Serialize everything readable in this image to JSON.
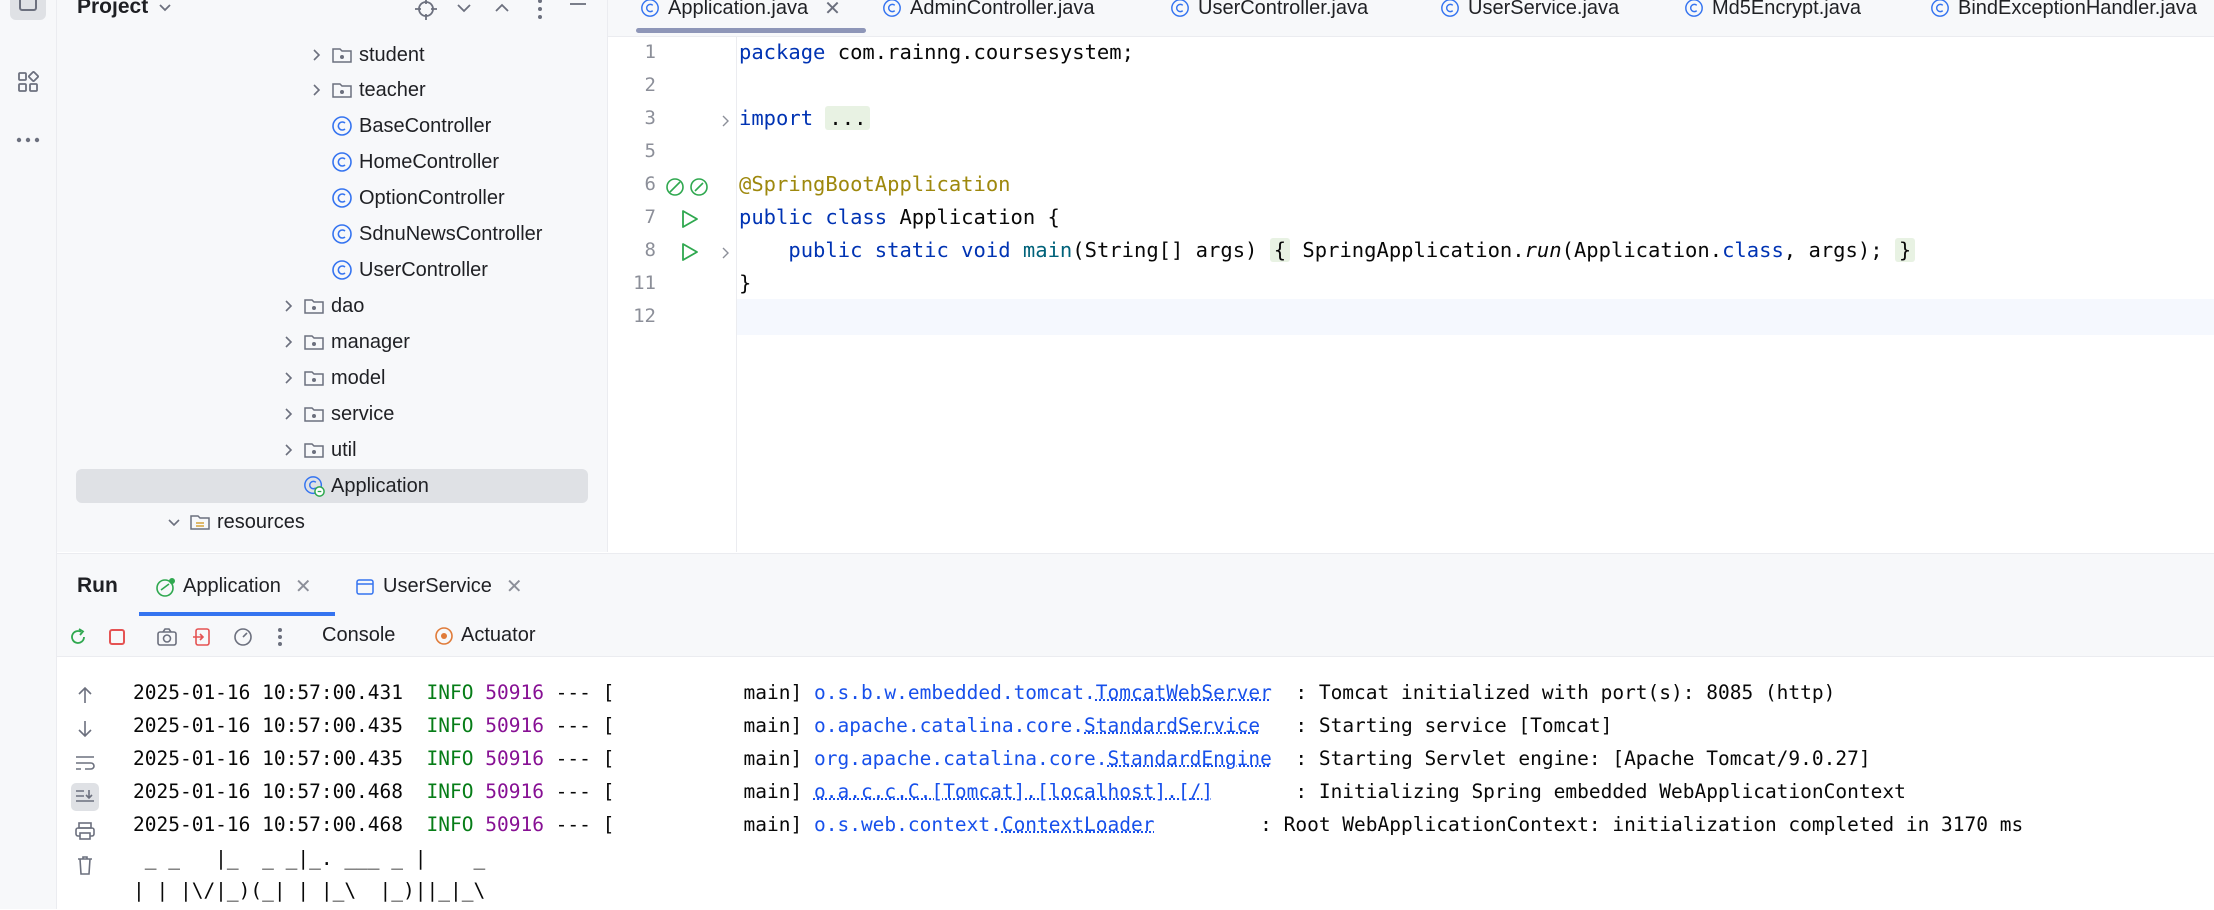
{
  "project_panel": {
    "title": "Project",
    "tree": [
      {
        "label": "student",
        "kind": "folder"
      },
      {
        "label": "teacher",
        "kind": "folder"
      },
      {
        "label": "BaseController",
        "kind": "class"
      },
      {
        "label": "HomeController",
        "kind": "class"
      },
      {
        "label": "OptionController",
        "kind": "class"
      },
      {
        "label": "SdnuNewsController",
        "kind": "class"
      },
      {
        "label": "UserController",
        "kind": "class"
      },
      {
        "label": "dao",
        "kind": "folder"
      },
      {
        "label": "manager",
        "kind": "folder"
      },
      {
        "label": "model",
        "kind": "folder"
      },
      {
        "label": "service",
        "kind": "folder"
      },
      {
        "label": "util",
        "kind": "folder"
      },
      {
        "label": "Application",
        "kind": "spring-class"
      },
      {
        "label": "resources",
        "kind": "resources-folder"
      }
    ]
  },
  "editor_tabs": [
    {
      "label": "Application.java"
    },
    {
      "label": "AdminController.java"
    },
    {
      "label": "UserController.java"
    },
    {
      "label": "UserService.java"
    },
    {
      "label": "Md5Encrypt.java"
    },
    {
      "label": "BindExceptionHandler.java"
    }
  ],
  "editor": {
    "line_numbers": [
      "1",
      "2",
      "3",
      "5",
      "6",
      "7",
      "8",
      "11",
      "12"
    ],
    "code": {
      "package_kw": "package",
      "package_name": " com.rainng.coursesystem;",
      "import_kw": "import",
      "import_fold": "...",
      "annotation": "@SpringBootApplication",
      "class_kw": "public class",
      "class_name": " Application {",
      "main_kw": "public static void",
      "main_name": "main",
      "main_params": "(String[] args) ",
      "main_fold_open": "{",
      "main_body_a": " SpringApplication.",
      "main_body_run": "run",
      "main_body_b": "(Application.",
      "main_body_class": "class",
      "main_body_c": ", args); ",
      "main_fold_close": "}",
      "closing": "}"
    }
  },
  "run_panel": {
    "title": "Run",
    "tabs": [
      {
        "label": "Application"
      },
      {
        "label": "UserService"
      }
    ],
    "console_tabs": [
      {
        "label": "Console"
      },
      {
        "label": "Actuator"
      }
    ],
    "log_lines": [
      {
        "ts": "2025-01-16 10:57:00.431",
        "level": "INFO",
        "pid": "50916",
        "sep": " --- [",
        "thread": "           main] ",
        "logger_prefix": "o.s.b.w.embedded.tomcat.",
        "logger_class": "TomcatWebServer",
        "pad": "  ",
        "msg": ": Tomcat initialized with port(s): 8085 (http)"
      },
      {
        "ts": "2025-01-16 10:57:00.435",
        "level": "INFO",
        "pid": "50916",
        "sep": " --- [",
        "thread": "           main] ",
        "logger_prefix": "o.apache.catalina.core.",
        "logger_class": "StandardService",
        "pad": "   ",
        "msg": ": Starting service [Tomcat]"
      },
      {
        "ts": "2025-01-16 10:57:00.435",
        "level": "INFO",
        "pid": "50916",
        "sep": " --- [",
        "thread": "           main] ",
        "logger_prefix": "org.apache.catalina.core.",
        "logger_class": "StandardEngine",
        "pad": "  ",
        "msg": ": Starting Servlet engine: [Apache Tomcat/9.0.27]"
      },
      {
        "ts": "2025-01-16 10:57:00.468",
        "level": "INFO",
        "pid": "50916",
        "sep": " --- [",
        "thread": "           main] ",
        "logger_prefix": "o.a.c.c.C.[Tomcat].[localhost].[/]",
        "logger_class": "",
        "pad": "       ",
        "msg": ": Initializing Spring embedded WebApplicationContext"
      },
      {
        "ts": "2025-01-16 10:57:00.468",
        "level": "INFO",
        "pid": "50916",
        "sep": " --- [",
        "thread": "           main] ",
        "logger_prefix": "o.s.web.context.",
        "logger_class": "ContextLoader",
        "pad": "         ",
        "msg": ": Root WebApplicationContext: initialization completed in 3170 ms"
      }
    ],
    "ascii_art": [
      " _ _   |_  _ _|_. ___ _ |    _ ",
      "| | |\\/|_)(_| | |_\\  |_)||_|_\\ "
    ]
  },
  "colors": {
    "accent": "#3574f0",
    "keyword": "#0033b3",
    "annotation": "#9e880d",
    "info_green": "#067d17",
    "pid_purple": "#871094",
    "logger_blue": "#1750eb",
    "run_green": "#2fa84f",
    "stop_red": "#e55353"
  },
  "icons": {
    "class": "class-c-icon",
    "folder": "package-folder-icon",
    "run": "run-triangle-icon",
    "stop": "stop-icon"
  }
}
